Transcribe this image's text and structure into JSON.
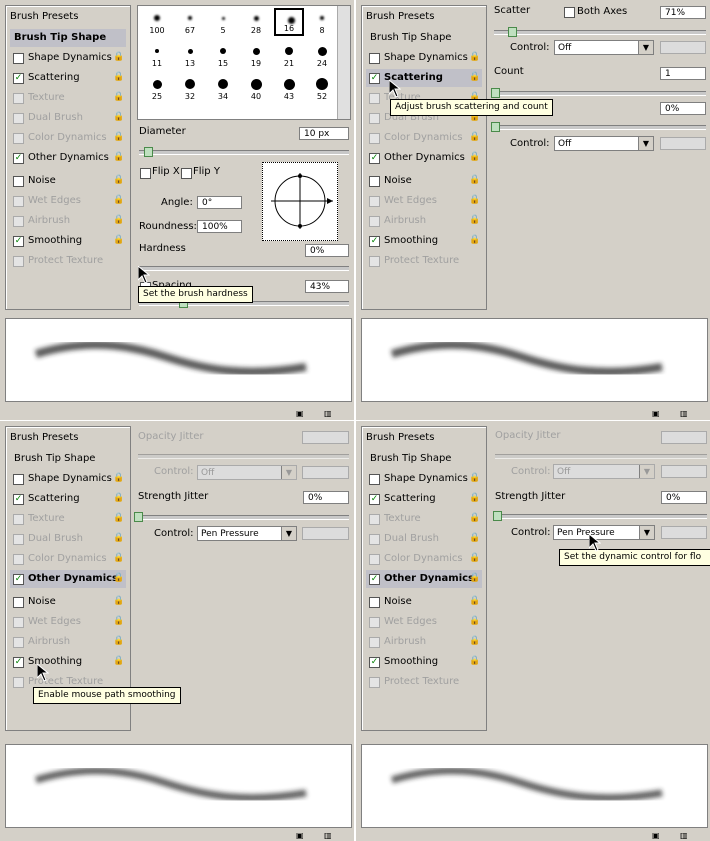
{
  "side": {
    "brush_presets": "Brush Presets",
    "brush_tip_shape": "Brush Tip Shape",
    "shape_dynamics": "Shape Dynamics",
    "scattering": "Scattering",
    "texture": "Texture",
    "dual_brush": "Dual Brush",
    "color_dynamics": "Color Dynamics",
    "other_dynamics": "Other Dynamics",
    "noise": "Noise",
    "wet_edges": "Wet Edges",
    "airbrush": "Airbrush",
    "smoothing": "Smoothing",
    "protect_texture": "Protect Texture"
  },
  "icons": {
    "check": "✓",
    "lock": "🔒",
    "arrow": "▼"
  },
  "q1": {
    "brush_sizes": [
      "100",
      "67",
      "5",
      "28",
      "16",
      "8",
      "11",
      "13",
      "15",
      "19",
      "21",
      "24",
      "25",
      "32",
      "34",
      "40",
      "43",
      "52"
    ],
    "diameter_label": "Diameter",
    "diameter_value": "10 px",
    "flip_x": "Flip X",
    "flip_y": "Flip Y",
    "angle_label": "Angle:",
    "angle_value": "0°",
    "roundness_label": "Roundness:",
    "roundness_value": "100%",
    "hardness_label": "Hardness",
    "hardness_value": "0%",
    "spacing_label": "Spacing",
    "spacing_value": "43%",
    "tooltip": "Set the brush hardness"
  },
  "q2": {
    "scatter_label": "Scatter",
    "both_axes": "Both Axes",
    "scatter_value": "71%",
    "control_label": "Control:",
    "control_value": "Off",
    "count_label": "Count",
    "count_value": "1",
    "count_jitter_value": "0%",
    "control2_label": "Control:",
    "control2_value": "Off",
    "tooltip": "Adjust brush scattering and count"
  },
  "q3": {
    "opacity_jitter": "Opacity Jitter",
    "control_label": "Control:",
    "control_value": "Off",
    "strength_jitter": "Strength Jitter",
    "strength_value": "0%",
    "control2_label": "Control:",
    "control2_value": "Pen Pressure",
    "tooltip": "Enable mouse path smoothing"
  },
  "q4": {
    "opacity_jitter": "Opacity Jitter",
    "control_label": "Control:",
    "control_value": "Off",
    "strength_jitter": "Strength Jitter",
    "strength_value": "0%",
    "control2_label": "Control:",
    "control2_value": "Pen Pressure",
    "tooltip": "Set the dynamic control for flo"
  }
}
